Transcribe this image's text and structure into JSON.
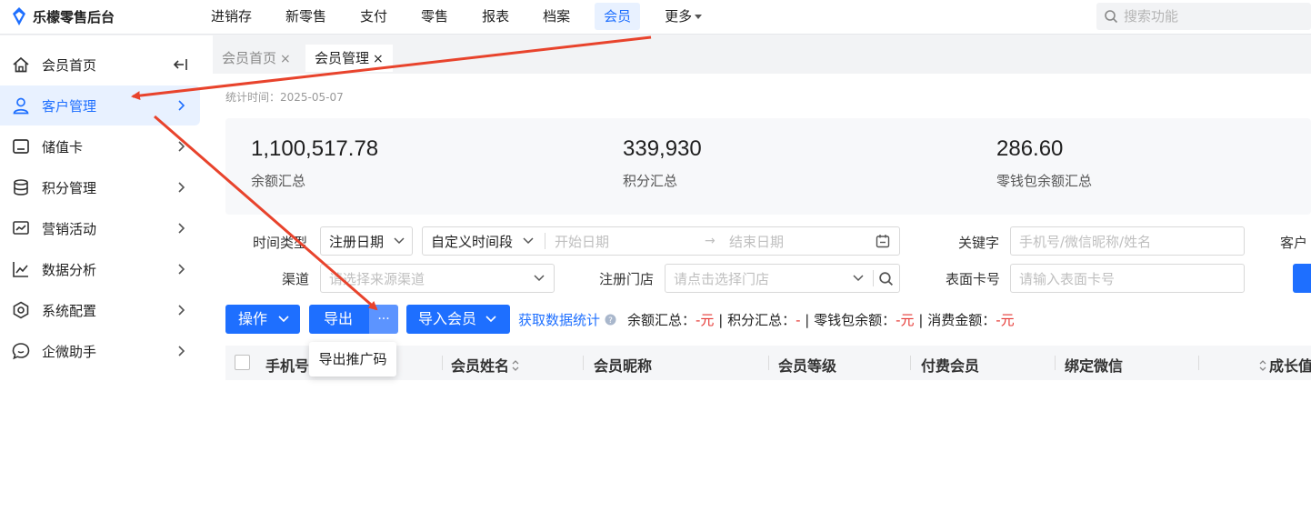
{
  "brand": {
    "name": "乐檬零售后台"
  },
  "top_nav": [
    {
      "label": "进销存",
      "active": false
    },
    {
      "label": "新零售",
      "active": false
    },
    {
      "label": "支付",
      "active": false
    },
    {
      "label": "零售",
      "active": false
    },
    {
      "label": "报表",
      "active": false
    },
    {
      "label": "档案",
      "active": false
    },
    {
      "label": "会员",
      "active": true
    },
    {
      "label": "更多",
      "active": false
    }
  ],
  "search": {
    "placeholder": "搜索功能"
  },
  "sidebar": {
    "items": [
      {
        "label": "会员首页",
        "icon": "home-icon"
      },
      {
        "label": "客户管理",
        "icon": "user-icon",
        "active": true
      },
      {
        "label": "储值卡",
        "icon": "card-icon"
      },
      {
        "label": "积分管理",
        "icon": "database-icon"
      },
      {
        "label": "营销活动",
        "icon": "chart-board-icon"
      },
      {
        "label": "数据分析",
        "icon": "line-chart-icon"
      },
      {
        "label": "系统配置",
        "icon": "settings-icon"
      },
      {
        "label": "企微助手",
        "icon": "chat-icon"
      }
    ]
  },
  "tabs": [
    {
      "label": "会员首页",
      "close": "×",
      "active": false
    },
    {
      "label": "会员管理",
      "close": "×",
      "active": true
    }
  ],
  "stat_time": "统计时间：2025-05-07",
  "stats": [
    {
      "value": "1,100,517.78",
      "label": "余额汇总"
    },
    {
      "value": "339,930",
      "label": "积分汇总"
    },
    {
      "value": "286.60",
      "label": "零钱包余额汇总"
    }
  ],
  "filters": {
    "time_type_label": "时间类型",
    "time_type_value": "注册日期",
    "period_value": "自定义时间段",
    "start_placeholder": "开始日期",
    "range_arrow": "→",
    "end_placeholder": "结束日期",
    "keyword_label": "关键字",
    "keyword_placeholder": "手机号/微信昵称/姓名",
    "cut_label": "客户",
    "channel_label": "渠道",
    "channel_placeholder": "请选择来源渠道",
    "store_label": "注册门店",
    "store_placeholder": "请点击选择门店",
    "card_label": "表面卡号",
    "card_placeholder": "请输入表面卡号"
  },
  "actions": {
    "operate": "操作",
    "export": "导出",
    "more": "···",
    "import": "导入会员",
    "get_stats": "获取数据统计",
    "summary": {
      "balance_label": "余额汇总：",
      "balance_value": "-元",
      "sep1": "|",
      "points_label": "积分汇总：",
      "points_value": "-",
      "sep2": "|",
      "wallet_label": "零钱包余额：",
      "wallet_value": "-元",
      "sep3": "|",
      "consume_label": "消费金额：",
      "consume_value": "-元"
    }
  },
  "table": {
    "columns": [
      "手机号",
      "会员姓名",
      "会员昵称",
      "会员等级",
      "付费会员",
      "绑定微信",
      "成长值"
    ]
  },
  "dropdown": {
    "item": "导出推广码"
  },
  "colors": {
    "accent": "#1e6fff",
    "arrow": "#e8432c",
    "negative": "#e53935"
  }
}
